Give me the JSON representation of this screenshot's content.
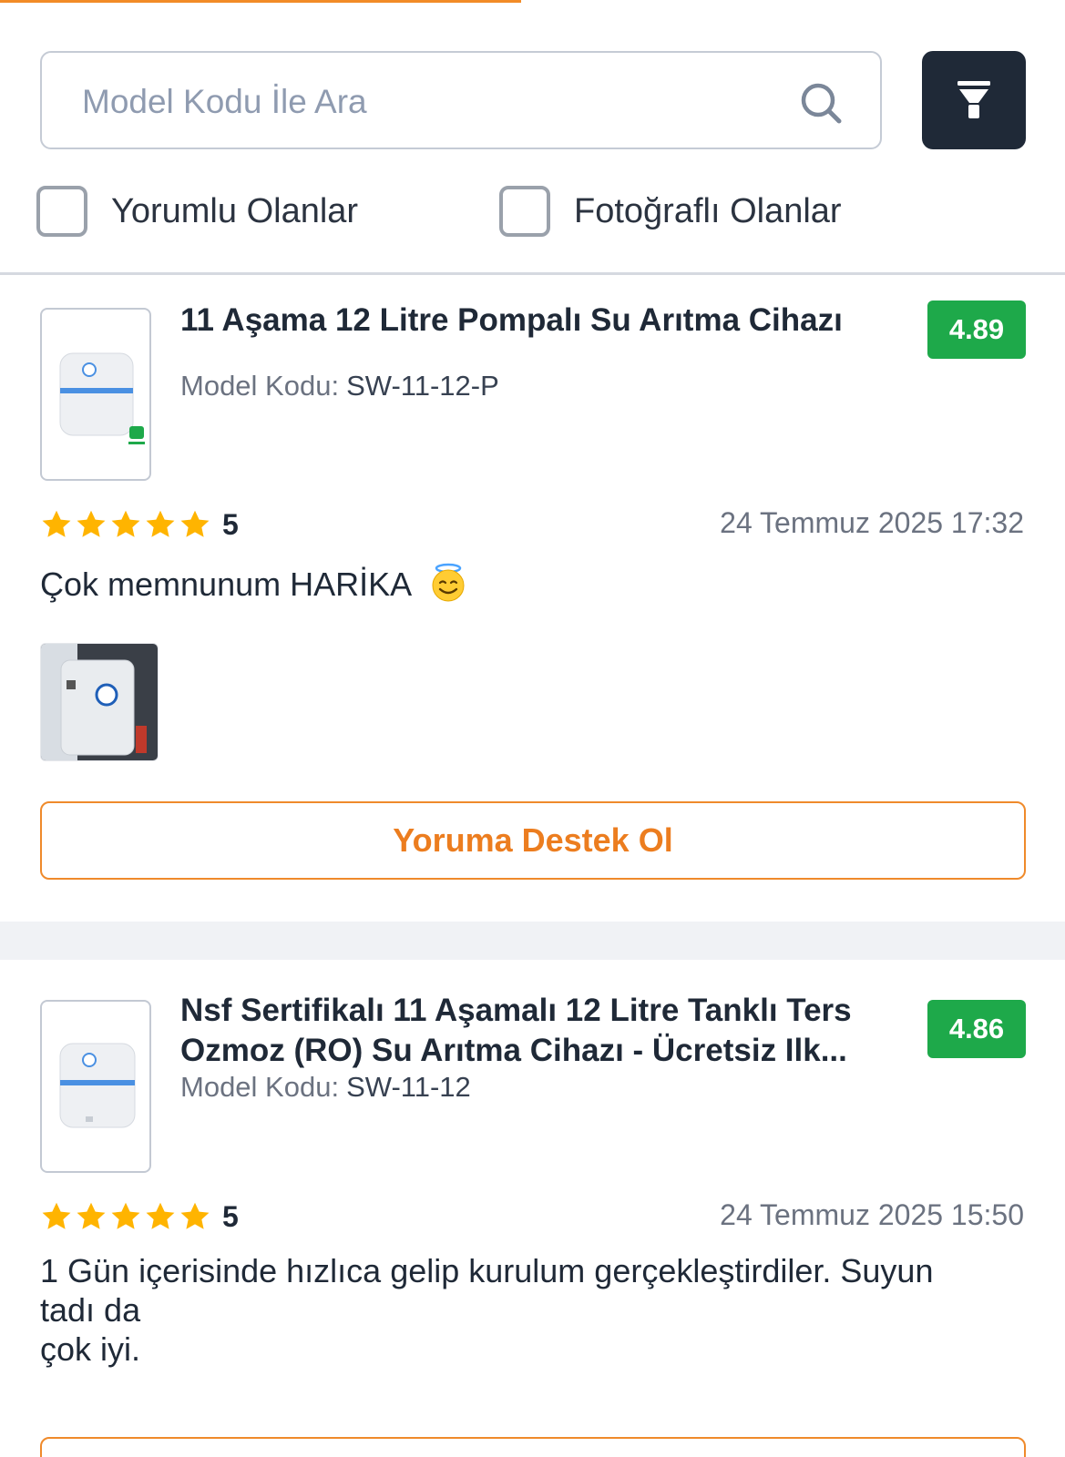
{
  "search": {
    "placeholder": "Model Kodu İle Ara",
    "value": ""
  },
  "filters": {
    "with_comments": {
      "label": "Yorumlu Olanlar",
      "checked": false
    },
    "with_photos": {
      "label": "Fotoğraflı Olanlar",
      "checked": false
    }
  },
  "colors": {
    "accent_orange": "#ef8a2b",
    "rating_green": "#1ea94a",
    "filter_button_bg": "#1f2937",
    "star_yellow": "#ffb400"
  },
  "reviews": [
    {
      "product_title": "11 Aşama 12 Litre Pompalı Su Arıtma Cihazı",
      "model_label": "Model Kodu:",
      "model_code": "SW-11-12-P",
      "product_rating": "4.89",
      "stars": 5,
      "star_value": "5",
      "date": "24 Temmuz 2025 17:32",
      "text": "Çok memnunum HARİKA",
      "emoji": "smiling-face-with-halo",
      "has_photo": true,
      "support_label": "Yoruma Destek Ol"
    },
    {
      "product_title": "Nsf Sertifikalı 11 Aşamalı 12 Litre Tanklı Ters Ozmoz (RO) Su Arıtma Cihazı - Ücretsiz Ilk...",
      "model_label": "Model Kodu:",
      "model_code": "SW-11-12",
      "product_rating": "4.86",
      "stars": 5,
      "star_value": "5",
      "date": "24 Temmuz 2025 15:50",
      "text_line1": "1 Gün içerisinde hızlıca gelip kurulum gerçekleştirdiler. Suyun",
      "text_line2": "tadı da",
      "text_line3": "çok iyi.",
      "has_photo": false
    }
  ]
}
